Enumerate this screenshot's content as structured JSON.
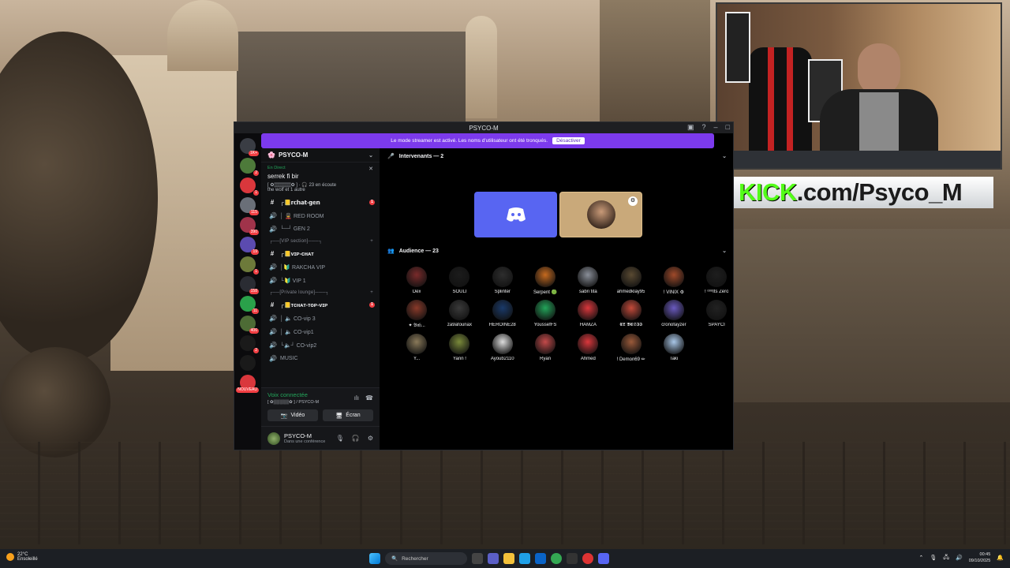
{
  "window": {
    "title": "PSYCO-M"
  },
  "banner": {
    "text": "Le mode streamer est activé. Les noms d'utilisateur ont été tronqués.",
    "button": "Désactiver"
  },
  "servers": [
    {
      "color": "#3a3d44",
      "badge": "1K+"
    },
    {
      "color": "#4d7a3a",
      "badge": "2"
    },
    {
      "color": "#da373c",
      "badge": "1"
    },
    {
      "color": "#6a6f78",
      "badge": "115"
    },
    {
      "color": "#a0334a",
      "badge": "390"
    },
    {
      "color": "#5b4bb0",
      "badge": "19"
    },
    {
      "color": "#6d7a3a",
      "badge": "1"
    },
    {
      "color": "#2a2c33",
      "badge": "158"
    },
    {
      "color": "#2aa14a",
      "badge": "11"
    },
    {
      "color": "#4d6b35",
      "badge": "406"
    },
    {
      "color": "#1a1a1a",
      "badge": "2"
    },
    {
      "color": "#1a1a1a",
      "badge": ""
    },
    {
      "color": "#da373c",
      "badge": "NOUVEAU"
    }
  ],
  "server_name": "PSYCO-M",
  "live": {
    "label": "En Direct",
    "title": "serrek fi bir",
    "info": "[ ✿▒▒▒▒▒✿ ] · 🎧 23 en écoute",
    "sub": "the wolf et 1 autre"
  },
  "channels": [
    {
      "icon": "#",
      "name": "┌📒𝕣𝕔𝕙𝕒𝕥-𝕘𝕖𝕟",
      "bold": true,
      "unread": "1",
      "caret": true
    },
    {
      "icon": "🔊",
      "name": "│ 💂 RED ROOM"
    },
    {
      "icon": "🔊",
      "name": "└─┘ GEN 2"
    },
    {
      "cat": "┌──[VIP section]───┐"
    },
    {
      "icon": "#",
      "name": "┌📒ᴠɪᴘ-ᴄʜᴀᴛ",
      "bold": true,
      "caret": true
    },
    {
      "icon": "🔊",
      "name": "│🔰 RAKCHA VIP"
    },
    {
      "icon": "🔊",
      "name": "└🔰 VIP 1"
    },
    {
      "cat": "┌──[Private lounge]───┐"
    },
    {
      "icon": "#",
      "name": "┌📒ᴛᴄʜᴀᴛ-ᴛᴏᴘ-ᴠɪᴘ",
      "bold": true,
      "unread": "1",
      "caret": true
    },
    {
      "icon": "🔊",
      "name": "│ 🔈 CO-vip 3"
    },
    {
      "icon": "🔊",
      "name": "│ 🔈 CO-vip1"
    },
    {
      "icon": "🔊",
      "name": "└🔈┘ CO-vip2"
    },
    {
      "icon": "🔊",
      "name": "MUSIC"
    }
  ],
  "voice": {
    "status": "Voix connectée",
    "where": "[ ✿▒▒▒▒▒✿ ] / PSYCO-M",
    "video": "Vidéo",
    "screen": "Écran"
  },
  "user": {
    "name": "PSYCO-M",
    "status": "Dans une conférence"
  },
  "stage": {
    "speakers_label": "Intervenants — 2",
    "audience_label": "Audience — 23",
    "audience": [
      {
        "name": "Dex",
        "color": "#7a2b2b"
      },
      {
        "name": "SOULI",
        "color": "#1c1c1c"
      },
      {
        "name": "Splinter",
        "color": "#2e2e2e"
      },
      {
        "name": "Serpent 🟢",
        "color": "#c66a1f"
      },
      {
        "name": "sabri tita",
        "color": "#8a8f99"
      },
      {
        "name": "ahmedklay95",
        "color": "#5a4a32"
      },
      {
        "name": "! VINIX ⚙",
        "color": "#a04a2a"
      },
      {
        "name": "! ᵒᵒᵒIts Zero",
        "color": "#1e1e1e"
      },
      {
        "name": "✦ 𝔅𝔞𝔥...",
        "color": "#8a3a2a"
      },
      {
        "name": "za9afounax",
        "color": "#3a3a3a"
      },
      {
        "name": "HEROINE28",
        "color": "#1a3a6a"
      },
      {
        "name": "YoussefFS",
        "color": "#23a55a"
      },
      {
        "name": "HAMZA",
        "color": "#da373c"
      },
      {
        "name": "𝕰𝕷 𝕭𝕰𝕾𝕴𝕴",
        "color": "#c44a3a"
      },
      {
        "name": "cronofayzer",
        "color": "#6a5ac0"
      },
      {
        "name": "SPAYCI",
        "color": "#222"
      },
      {
        "name": "Y...",
        "color": "#8a7a5a"
      },
      {
        "name": "Yann !",
        "color": "#7a8a3a"
      },
      {
        "name": "Ayoub2110",
        "color": "#ddd"
      },
      {
        "name": "Ryan",
        "color": "#c44a4a"
      },
      {
        "name": "Ahmed",
        "color": "#da373c"
      },
      {
        "name": "! Demon69 ✏",
        "color": "#9a5a3a"
      },
      {
        "name": "Taki",
        "color": "#a9c7e8"
      }
    ]
  },
  "overlay": {
    "kick_a": "KICK",
    "kick_b": ".com/Psyco_M"
  },
  "taskbar": {
    "temp": "22°C",
    "weather": "Ensoleillé",
    "search": "Rechercher",
    "time": "00:45",
    "date": "09/10/2025"
  }
}
